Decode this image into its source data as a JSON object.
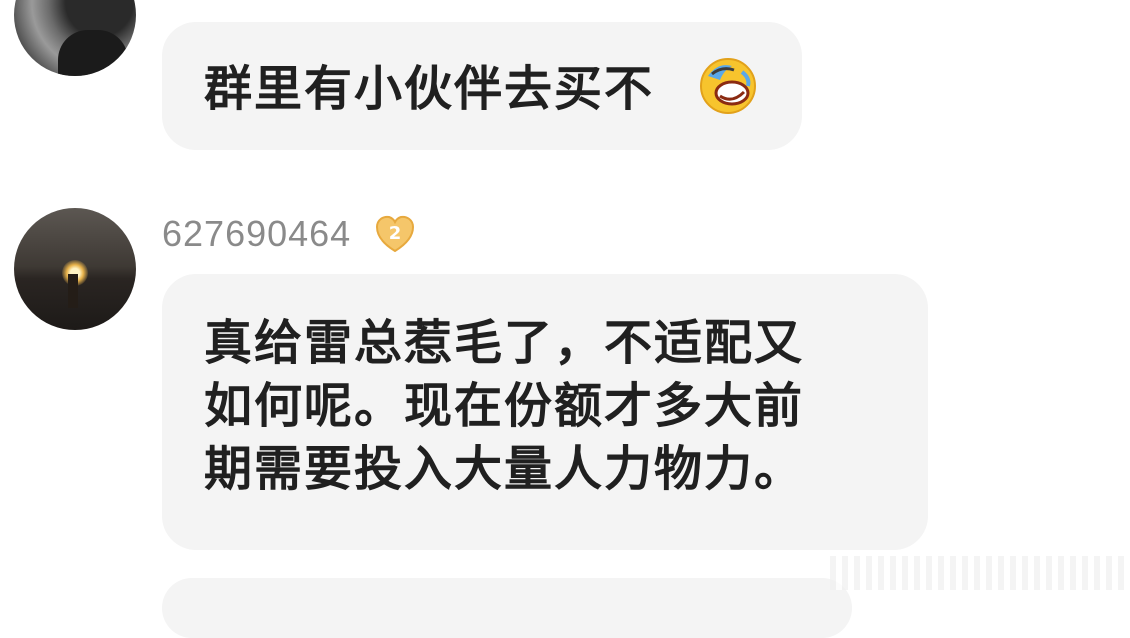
{
  "messages": [
    {
      "text": "群里有小伙伴去买不",
      "emoji": "rolling-on-floor-laughing-icon"
    },
    {
      "username": "627690464",
      "badge_level": "2",
      "text": "真给雷总惹毛了，不适配又\n如何呢。现在份额才多大前\n期需要投入大量人力物力。"
    }
  ],
  "colors": {
    "bubble": "#f4f4f4",
    "text": "#202020",
    "username": "#8a8a8a",
    "badge": "#f5c66a"
  }
}
